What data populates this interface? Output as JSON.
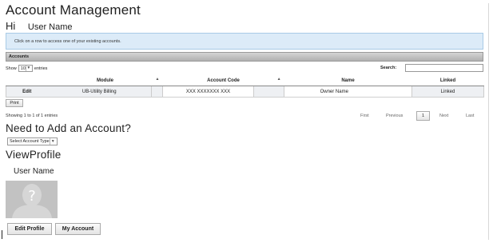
{
  "page": {
    "title": "Account Management",
    "greeting": "Hi",
    "user_name": "User Name"
  },
  "info": {
    "message": "Click on a row to access one of your existing accounts."
  },
  "accounts": {
    "section_label": "Accounts",
    "show_label": "Show",
    "page_size": "10",
    "entries_label": "entries",
    "search_label": "Search:",
    "search_value": "",
    "columns": [
      "Module",
      "Account Code",
      "Name",
      "Linked"
    ],
    "rows": [
      {
        "action": "Edit",
        "module": "UB-Utility Billing",
        "account_code": "XXX XXXXXXX XXX",
        "name": "Owner Name",
        "linked": "Linked"
      }
    ],
    "print_label": "Print",
    "showing_text": "Showing 1 to 1 of 1 entries",
    "pager": {
      "first": "First",
      "previous": "Previous",
      "current": "1",
      "next": "Next",
      "last": "Last"
    }
  },
  "add_account": {
    "heading": "Need to Add an Account?",
    "select_value": "Select Account Type"
  },
  "profile": {
    "heading": "ViewProfile",
    "user_name": "User Name",
    "edit_label": "Edit Profile",
    "account_label": "My Account"
  },
  "colors": {
    "info_bg": "#dcebf8",
    "info_border": "#a9cbe6",
    "header_bar": "#b0b0b0",
    "avatar_bg": "#bfbfbf"
  },
  "icons": [
    "sort-up-icon",
    "dropdown-arrow-icon",
    "avatar-placeholder-icon"
  ]
}
